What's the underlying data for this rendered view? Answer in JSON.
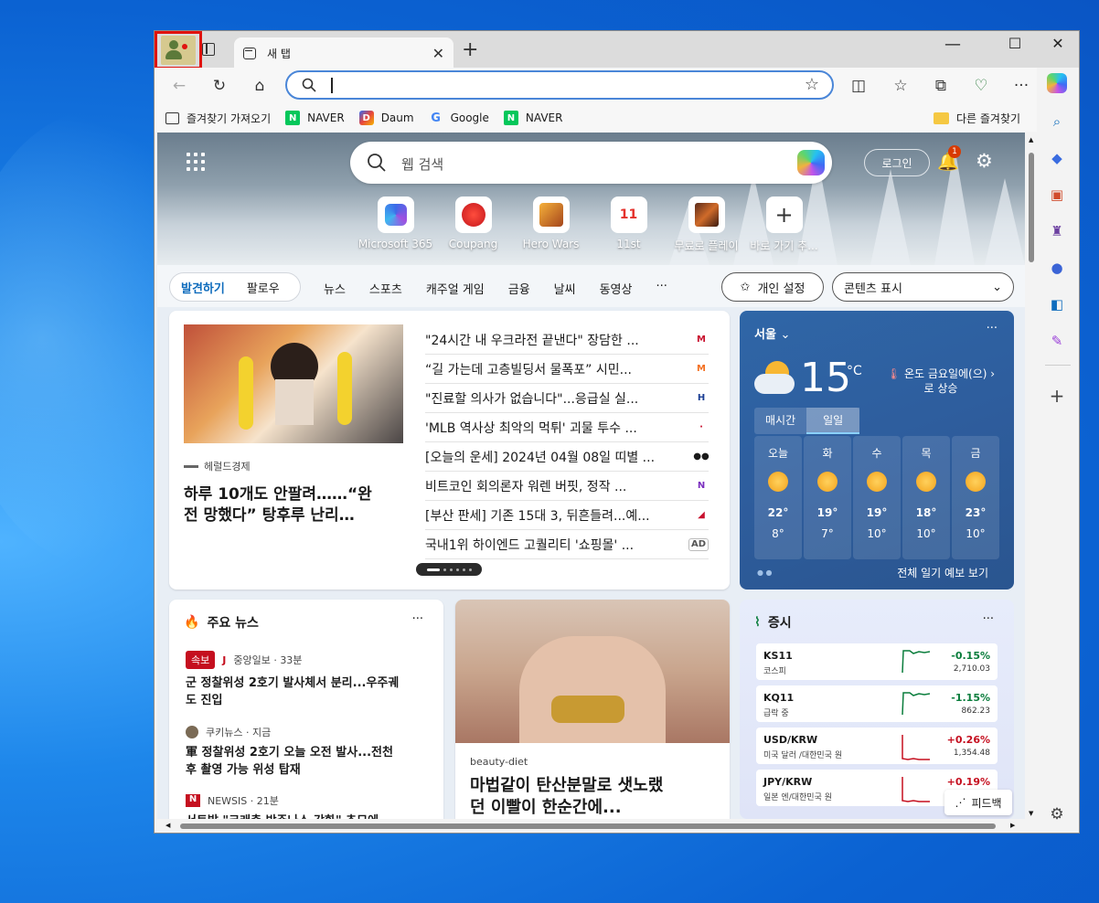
{
  "browser": {
    "tab_title": "새 탭",
    "address_value": "",
    "bookmarks": [
      {
        "label": "즐겨찾기 가져오기",
        "icon": "import-favorites-icon"
      },
      {
        "label": "NAVER",
        "icon": "naver-icon"
      },
      {
        "label": "Daum",
        "icon": "daum-icon"
      },
      {
        "label": "Google",
        "icon": "google-icon"
      },
      {
        "label": "NAVER",
        "icon": "naver-icon"
      }
    ],
    "other_favorites": "다른 즐겨찾기"
  },
  "newtab": {
    "search_placeholder": "웹 검색",
    "login": "로그인",
    "notif_count": "1",
    "quicklinks": [
      {
        "label": "Microsoft 365"
      },
      {
        "label": "Coupang"
      },
      {
        "label": "Hero Wars"
      },
      {
        "label": "11st",
        "icon_text": "11"
      },
      {
        "label": "무료로 플레이"
      },
      {
        "label": "바로 가기 추..."
      }
    ],
    "nav": {
      "discover": "발견하기",
      "follow": "팔로우",
      "items": [
        "뉴스",
        "스포츠",
        "캐주얼 게임",
        "금융",
        "날씨",
        "동영상",
        "···"
      ],
      "personalize": "개인 설정",
      "content_view": "콘텐츠 표시"
    }
  },
  "featured": {
    "source": "헤럴드경제",
    "title_line1": "하루 10개도 안팔려……“완",
    "title_line2": "전 망했다” 탕후루 난리…",
    "headlines": [
      {
        "text": "\"24시간 내 우크라전 끝낸다\" 장담한 ...",
        "logo": "M",
        "color": "#c8102e"
      },
      {
        "text": "“길 가는데 고층빌딩서 물폭포” 시민...",
        "logo": "M",
        "color": "#f37021"
      },
      {
        "text": "\"진료할 의사가 없습니다\"...응급실 실...",
        "logo": "H",
        "color": "#1c3f94"
      },
      {
        "text": "'MLB 역사상 최악의 먹튀' 괴물 투수 ...",
        "logo": "·",
        "color": "#c8102e"
      },
      {
        "text": "[오늘의 운세] 2024년 04월 08일 띠별 ...",
        "logo": "●●",
        "color": "#1a1a1a"
      },
      {
        "text": "비트코인 회의론자 워렌 버핏, 정작 ...",
        "logo": "N",
        "color": "#7b2fbf"
      },
      {
        "text": "[부산 판세] 기존 15대 3, 뒤흔들려...예...",
        "logo": "◢",
        "color": "#c8102e"
      },
      {
        "text": "국내1위 하이엔드 고퀄리티 '쇼핑몰' ...",
        "logo": "AD",
        "color": "#555"
      }
    ]
  },
  "weather": {
    "city": "서울",
    "temp": "15",
    "unit": "°C",
    "note_line1": "온도 금요일에(으)",
    "note_line2": "로 상승",
    "tabs": [
      "매시간",
      "일일"
    ],
    "days": [
      {
        "day": "오늘",
        "hi": "22°",
        "lo": "8°"
      },
      {
        "day": "화",
        "hi": "19°",
        "lo": "7°"
      },
      {
        "day": "수",
        "hi": "19°",
        "lo": "10°"
      },
      {
        "day": "목",
        "hi": "18°",
        "lo": "10°"
      },
      {
        "day": "금",
        "hi": "23°",
        "lo": "10°"
      }
    ],
    "forecast_link": "전체 일기 예보 보기"
  },
  "topnews": {
    "title": "주요 뉴스",
    "items": [
      {
        "badge": "속보",
        "source": "중앙일보 · 33분",
        "title_line1": "군 정찰위성 2호기 발사체서 분리...우주궤",
        "title_line2": "도 진입"
      },
      {
        "source": "쿠키뉴스 · 지금",
        "title_line1": "軍 정찰위성 2호기 오늘 오전 발사...전천",
        "title_line2": "후 촬영 가능 위성 탑재"
      },
      {
        "source": "NEWSIS · 21분",
        "title_line1": "서트발 \"크래층 박주나스 강화\" 추모에..."
      }
    ]
  },
  "middle": {
    "source": "beauty-diet",
    "title_line1": "마법같이 탄산분말로 샛노랬",
    "title_line2": "던 이빨이 한순간에..."
  },
  "stocks": {
    "title": "증시",
    "rows": [
      {
        "name": "KS11",
        "sub": "코스피",
        "change": "-0.15%",
        "price": "2,710.03",
        "dir": "down"
      },
      {
        "name": "KQ11",
        "sub": "급락 중",
        "change": "-1.15%",
        "price": "862.23",
        "dir": "down"
      },
      {
        "name": "USD/KRW",
        "sub": "미국 달러 /대한민국 원",
        "change": "+0.26%",
        "price": "1,354.48",
        "dir": "up"
      },
      {
        "name": "JPY/KRW",
        "sub": "일본 엔/대한민국 원",
        "change": "+0.19%",
        "price": "",
        "dir": "up"
      }
    ],
    "feedback": "피드백"
  },
  "colors": {
    "accent": "#0f6cbd",
    "down": "#0a7d3c",
    "up": "#c50f1f"
  }
}
